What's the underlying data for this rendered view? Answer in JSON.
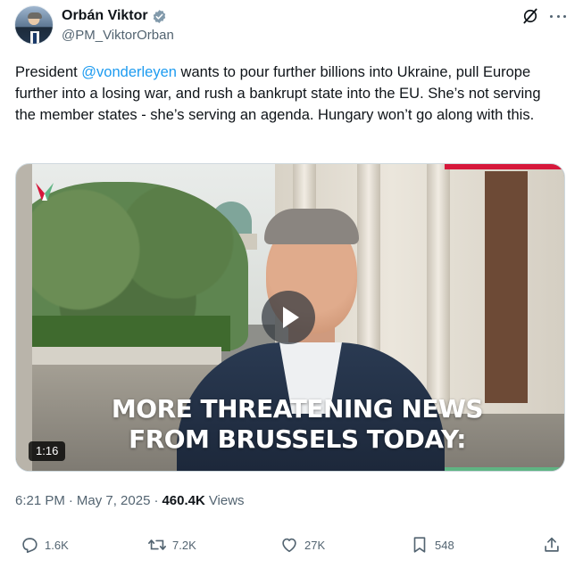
{
  "author": {
    "display_name": "Orbán Viktor",
    "handle": "@PM_ViktorOrban",
    "verified": true,
    "avatar_icon": "profile-photo-avatar"
  },
  "header_icons": {
    "grok": "grok-icon",
    "more": "more-icon"
  },
  "tweet": {
    "text_before_mention": "President ",
    "mention": "@vonderleyen",
    "text_after_mention": " wants to pour further billions into Ukraine, pull Europe further into a losing war, and rush a bankrupt state into the EU. She’s not serving the member states - she’s serving an agenda. Hungary won’t go along with this."
  },
  "media": {
    "type": "video",
    "caption_line1": "MORE THREATENING NEWS",
    "caption_line2": "FROM BRUSSELS TODAY:",
    "duration": "1:16",
    "play_icon": "play-icon"
  },
  "meta": {
    "time": "6:21 PM",
    "separator1": "·",
    "date": "May 7, 2025",
    "separator2": "·",
    "views_count": "460.4K",
    "views_label": "Views"
  },
  "actions": {
    "replies": "1.6K",
    "reposts": "7.2K",
    "likes": "27K",
    "bookmarks": "548"
  },
  "colors": {
    "accent": "#1d9bf0",
    "text_primary": "#0f1419",
    "text_secondary": "#536471",
    "verified_badge": "#829aab",
    "brand_red": "#d6183b",
    "brand_green": "#5fb483"
  }
}
